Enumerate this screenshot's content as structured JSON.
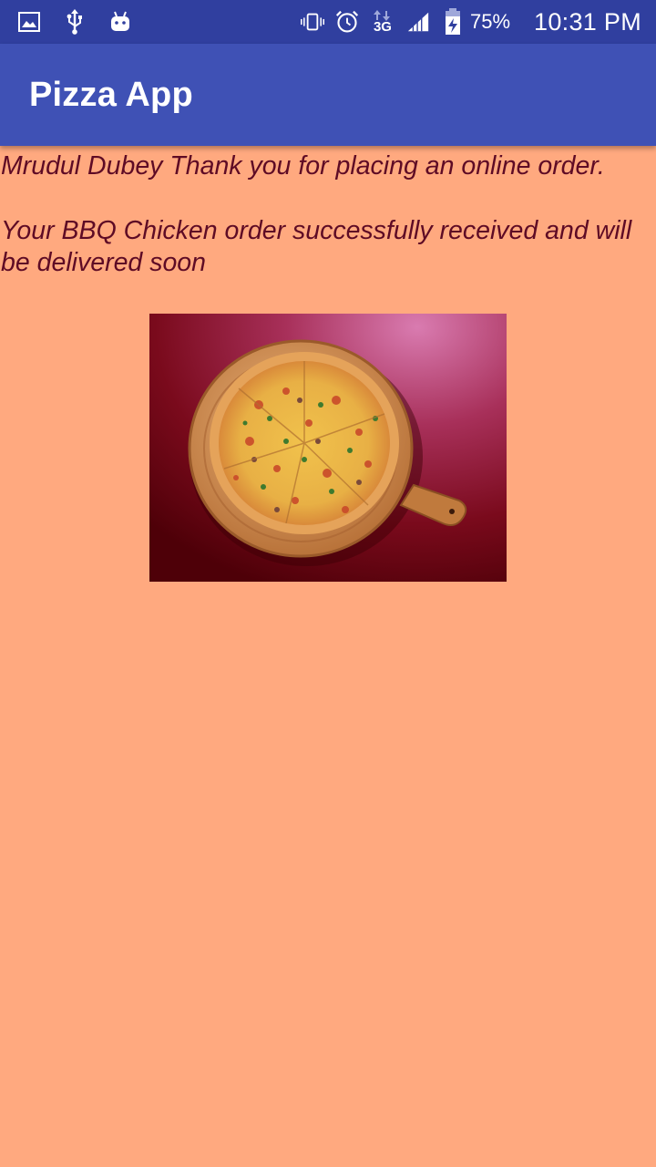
{
  "status_bar": {
    "left_icons": [
      "image-icon",
      "usb-icon",
      "android-icon"
    ],
    "right_icons": [
      "vibrate-icon",
      "alarm-icon",
      "3g-data-icon",
      "signal-icon",
      "battery-charging-icon"
    ],
    "network_label": "3G",
    "battery_percent": "75%",
    "time": "10:31 PM"
  },
  "app_bar": {
    "title": "Pizza App",
    "color": "#3F51B5"
  },
  "content": {
    "message_line1": "Mrudul Dubey Thank you for placing an online order.",
    "message_line2": "Your BBQ Chicken order successfully received and will be delivered soon",
    "text_color": "#5E0B25",
    "background": "#FFA97F",
    "image_icon": "pizza-image"
  }
}
